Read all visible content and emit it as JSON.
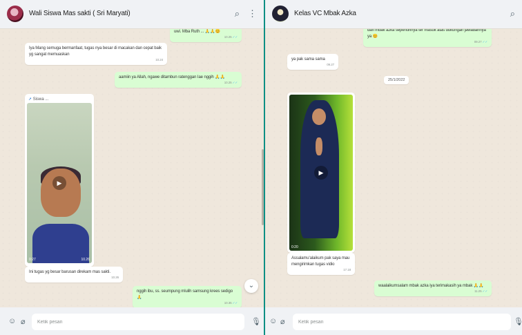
{
  "left": {
    "title": "Wali Siswa Mas sakti ( Sri Maryati)",
    "messages": [
      {
        "text": "uwi. Mba Ruth ... 🙏🙏😊",
        "time": "10.25"
      },
      {
        "text": "Iya Mang semuga bermanfaat, tugas nya besar di macakan dan cepat baik yg sangat memuaskan",
        "time": "10.24"
      },
      {
        "text": "aamiin ya Allah, ngawe ditambun ratenggan Iae nggih 🙏🙏",
        "time": "10.25"
      },
      {
        "text": "Ini tugas yg besar barusan direkam mas sakti.",
        "time": "10.26"
      },
      {
        "text": "nggih ibu, ss. seumpung mlulih samsung krees sedigo 🙏",
        "time": "10.35"
      }
    ],
    "video": {
      "label": "Siswa ...",
      "duration": "0:27",
      "time": "10.26"
    },
    "input_placeholder": "Ketik pesan"
  },
  "right": {
    "title": "Kelas VC Mbak Azka",
    "messages": [
      {
        "text": "dari mbak azka sepenuhnya ter masuk atas dukungan jawabannya ya 😊",
        "time": "09.27"
      },
      {
        "text": "ya pak sama sama",
        "time": "09.27"
      },
      {
        "text": "Assalamu'alaikum pak saya mau mengirimkan tugas vidio",
        "time": "17.18"
      },
      {
        "text": "waalaikumsalam mbak azka iya terimakasih ya mbak 🙏🙏",
        "time": "11.25"
      }
    ],
    "date_chip": "25/1/2022",
    "video": {
      "duration": "0:20",
      "time": ""
    },
    "input_placeholder": "Ketik pesan"
  }
}
